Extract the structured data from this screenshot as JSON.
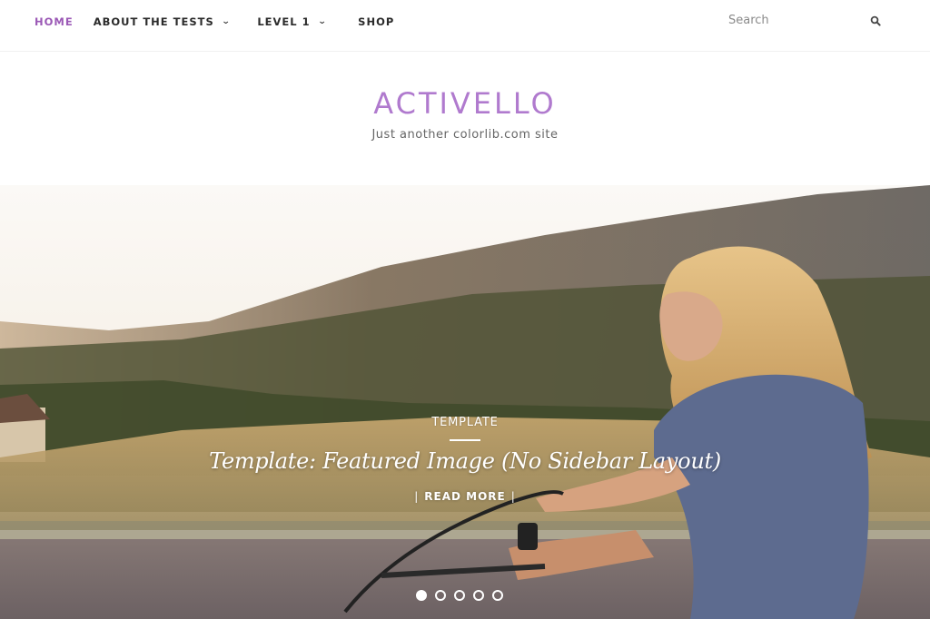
{
  "nav": {
    "items": [
      {
        "label": "Home",
        "active": true,
        "has_dropdown": false
      },
      {
        "label": "About The Tests",
        "active": false,
        "has_dropdown": true
      },
      {
        "label": "Level 1",
        "active": false,
        "has_dropdown": true
      },
      {
        "label": "Shop",
        "active": false,
        "has_dropdown": false
      }
    ],
    "dropdown_icon": "chevron-down-icon"
  },
  "search": {
    "placeholder": "Search",
    "value": "",
    "icon": "search-icon"
  },
  "branding": {
    "title": "ACTIVELLO",
    "description": "Just another colorlib.com site"
  },
  "hero": {
    "category": "TEMPLATE",
    "title": "Template: Featured Image (No Sidebar Layout)",
    "read_more": "READ MORE",
    "slides_total": 5,
    "active_slide": 1
  },
  "colors": {
    "accent": "#9b59b6",
    "title": "#a86cc9",
    "nav_text": "#2b2b2b"
  }
}
